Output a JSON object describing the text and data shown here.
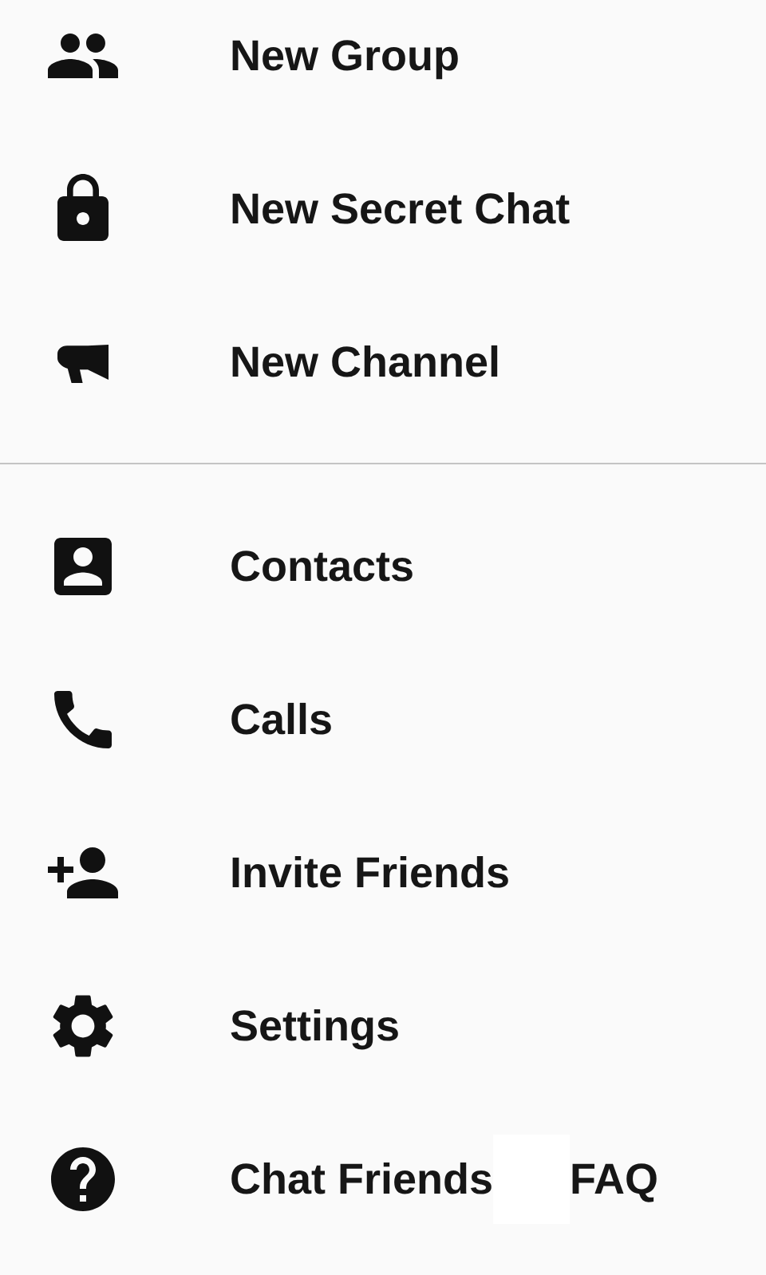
{
  "sections": [
    {
      "items": [
        {
          "kind": "group",
          "label": "New Group"
        },
        {
          "kind": "lock",
          "label": "New Secret Chat"
        },
        {
          "kind": "megaphone",
          "label": "New Channel"
        }
      ]
    },
    {
      "items": [
        {
          "kind": "contact",
          "label": "Contacts"
        },
        {
          "kind": "phone",
          "label": "Calls"
        },
        {
          "kind": "person_add",
          "label": "Invite Friends"
        },
        {
          "kind": "settings",
          "label": "Settings"
        },
        {
          "kind": "help",
          "label": "Chat Friends",
          "label_end": "FAQ"
        }
      ]
    }
  ]
}
